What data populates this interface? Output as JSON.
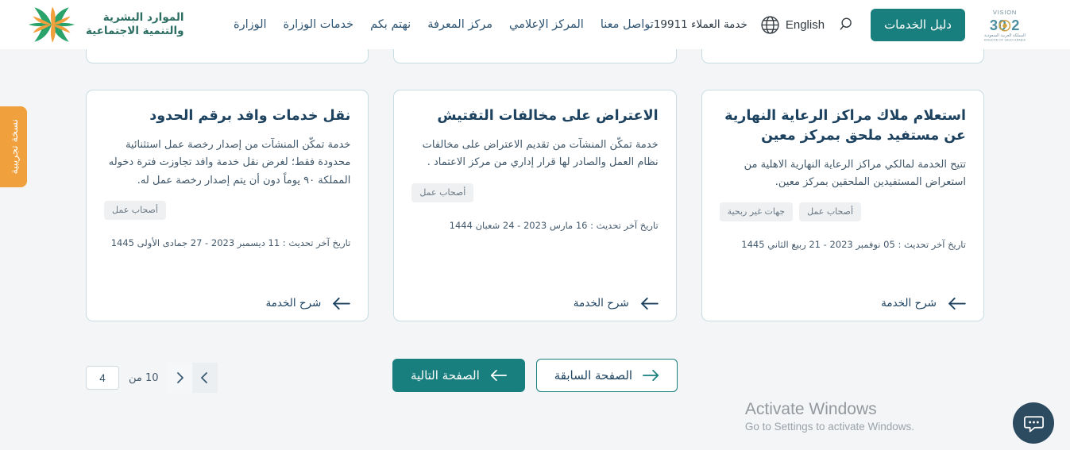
{
  "header": {
    "brand": {
      "logo_icon": "hrsd-star-logo",
      "line1": "الموارد البشرية",
      "line2": "والتنمية الاجتماعية"
    },
    "nav_items": [
      {
        "label": "الوزارة",
        "name": "nav-ministry"
      },
      {
        "label": "خدمات الوزارة",
        "name": "nav-ministry-services"
      },
      {
        "label": "نهتم بكم",
        "name": "nav-we-care"
      },
      {
        "label": "مركز المعرفة",
        "name": "nav-knowledge-center"
      },
      {
        "label": "المركز الإعلامي",
        "name": "nav-media-center"
      },
      {
        "label": "تواصل معنا",
        "name": "nav-contact-us"
      }
    ],
    "customer_service": "خدمة العملاء 19911",
    "language_label": "English",
    "language_icon": "globe-icon",
    "search_icon": "search-icon",
    "guide_button": "دليل الخدمات",
    "vision_logo": "vision-2030-logo"
  },
  "beta_tab": {
    "label": "نسخة تجريبية"
  },
  "cards": [
    {
      "name": "card-daycare-inquiry",
      "title": "استعلام ملاك مراكز الرعاية النهارية عن مستفيد ملحق بمركز معين",
      "description": "تتيح الخدمة لمالكي مراكز الرعاية النهارية الاهلية من استعراض المستفيدين الملحقين بمركز معين.",
      "chips": [
        "جهات غير ربحية",
        "أصحاب عمل"
      ],
      "date": "تاريخ آخر تحديث : 05 نوفمبر 2023 - 21 ربيع الثاني 1445",
      "link_label": "شرح الخدمة",
      "link_icon": "arrow-left-icon"
    },
    {
      "name": "card-inspection-objection",
      "title": "الاعتراض على مخالفات التفتيش",
      "description": "خدمة تمكّن المنشآت من تقديم الاعتراض على مخالفات نظام العمل والصادر لها قرار إداري من مركز الاعتماد .",
      "chips": [
        "أصحاب عمل"
      ],
      "date": "تاريخ آخر تحديث : 16 مارس 2023 - 24 شعبان 1444",
      "link_label": "شرح الخدمة",
      "link_icon": "arrow-left-icon"
    },
    {
      "name": "card-transfer-expat-services",
      "title": "نقل خدمات وافد برقم الحدود",
      "description": "خدمة تمكّن المنشآت من إصدار رخصة عمل استثنائية محدودة فقط؛ لغرض نقل خدمة وافد تجاوزت فترة دخوله المملكة ٩٠ يوماً دون أن يتم إصدار رخصة عمل له.",
      "chips": [
        "أصحاب عمل"
      ],
      "date": "تاريخ آخر تحديث : 11 ديسمبر 2023 - 27 جمادى الأولى 1445",
      "link_label": "شرح الخدمة",
      "link_icon": "arrow-left-icon"
    }
  ],
  "pagination": {
    "prev_arrow_icon": "chevron-left-icon",
    "next_arrow_icon": "chevron-right-icon",
    "total_label": "من",
    "total_pages": "10",
    "current_page": "4",
    "next_page_button": "الصفحة التالية",
    "next_page_icon": "arrow-left-icon",
    "prev_page_button": "الصفحة السابقة",
    "prev_page_icon": "arrow-right-icon"
  },
  "watermark": {
    "title": "Activate Windows",
    "subtitle": "Go to Settings to activate Windows."
  },
  "chat": {
    "icon": "chat-bubble-icon"
  },
  "colors": {
    "teal": "#197e7e",
    "orange": "#f0a03c",
    "card_border": "#c7dde3",
    "page_bg": "#f4f5f6",
    "title_text": "#1d4260"
  }
}
